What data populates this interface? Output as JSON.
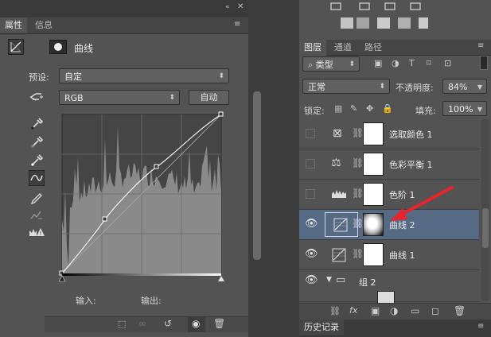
{
  "properties_panel": {
    "tabs": [
      "属性",
      "信息"
    ],
    "header_title": "曲线",
    "preset_label": "预设:",
    "preset_value": "自定",
    "channel_value": "RGB",
    "auto_button": "自动",
    "input_label": "输入:",
    "output_label": "输出:"
  },
  "layers_panel": {
    "tabs": [
      "图层",
      "通道",
      "路径"
    ],
    "filter_kind": "类型",
    "blend_mode": "正常",
    "opacity_label": "不透明度:",
    "opacity_value": "84%",
    "lock_label": "锁定:",
    "fill_label": "填充:",
    "fill_value": "100%",
    "layers": [
      {
        "name": "选取颜色 1",
        "icon": "selective-color-icon",
        "selected": false,
        "visible": false
      },
      {
        "name": "色彩平衡 1",
        "icon": "color-balance-icon",
        "selected": false,
        "visible": false
      },
      {
        "name": "色阶 1",
        "icon": "levels-icon",
        "selected": false,
        "visible": false
      },
      {
        "name": "曲线 2",
        "icon": "curves-icon",
        "selected": true,
        "visible": true
      },
      {
        "name": "曲线 1",
        "icon": "curves-icon",
        "selected": false,
        "visible": true
      }
    ],
    "group_name": "组 2"
  },
  "history_panel": {
    "tab": "历史记录"
  },
  "colors": {
    "panel_bg": "#535353",
    "selected_row": "#566a86",
    "annotation_arrow": "#e8232c"
  }
}
